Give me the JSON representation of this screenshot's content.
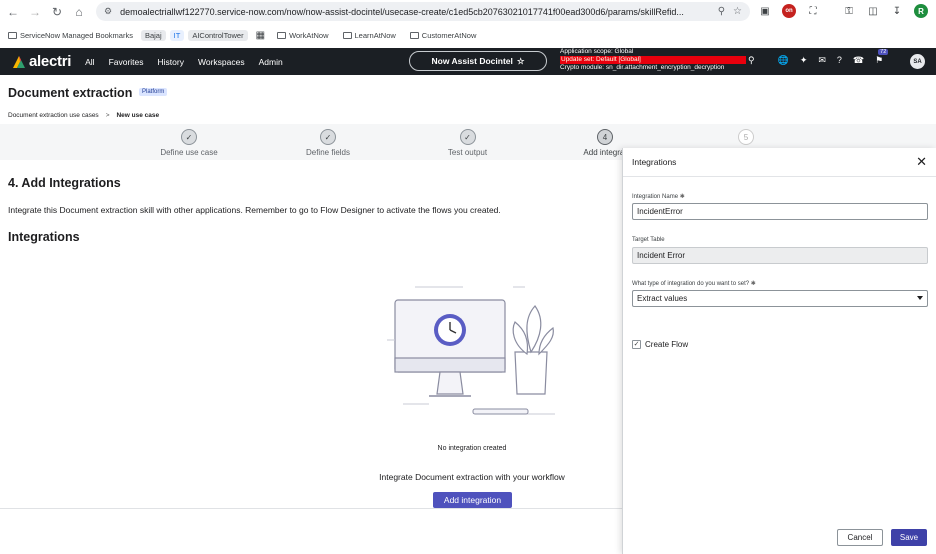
{
  "browser": {
    "url": "demoalectriallwf122770.service-now.com/now/now-assist-docintel/usecase-create/c1ed5cb20763021017741f00ead300d6/params/skillRefid...",
    "profile_initial": "R",
    "rec_badge": "on"
  },
  "bookmarks": {
    "items": [
      "ServiceNow Managed Bookmarks",
      "Bajaj",
      "IT",
      "AIControlTower",
      "WorkAtNow",
      "LearnAtNow",
      "CustomerAtNow"
    ]
  },
  "sn_header": {
    "logo": "alectri",
    "menu": [
      "All",
      "Favorites",
      "History",
      "Workspaces",
      "Admin"
    ],
    "center_pill": "Now Assist Docintel",
    "scope_line1": "Application scope: Global",
    "scope_line2": "Update set: Default [Global]",
    "scope_line3": "Crypto module: sn_dir.attachment_encryption_decryption",
    "notif_count": "72",
    "avatar": "SA"
  },
  "page": {
    "title": "Document extraction",
    "tag": "Platform",
    "breadcrumb_1": "Document extraction use cases",
    "breadcrumb_sep": ">",
    "breadcrumb_2": "New use case"
  },
  "stepper": {
    "steps": [
      {
        "label": "Define use case",
        "marker": "✓"
      },
      {
        "label": "Define fields",
        "marker": "✓"
      },
      {
        "label": "Test output",
        "marker": "✓"
      },
      {
        "label": "Add integrat",
        "marker": "4"
      },
      {
        "label": "",
        "marker": "5"
      }
    ]
  },
  "main": {
    "section_title": "4. Add Integrations",
    "description": "Integrate this Document extraction skill with other applications. Remember to go to Flow Designer to activate the flows you created.",
    "integrations_title": "Integrations",
    "empty_text": "No integration created",
    "cta_text": "Integrate Document extraction with your workflow",
    "add_button": "Add integration"
  },
  "panel": {
    "title": "Integrations",
    "name_label": "Integration Name",
    "name_value": "IncidentError",
    "table_label": "Target Table",
    "table_value": "Incident Error",
    "type_label": "What type of integration do you want to set?",
    "type_value": "Extract values",
    "checkbox_label": "Create Flow",
    "cancel": "Cancel",
    "save": "Save"
  },
  "colors": {
    "primary": "#4f52bd",
    "header_bg": "#1b1f24",
    "update_set_bg": "#e8000d"
  }
}
